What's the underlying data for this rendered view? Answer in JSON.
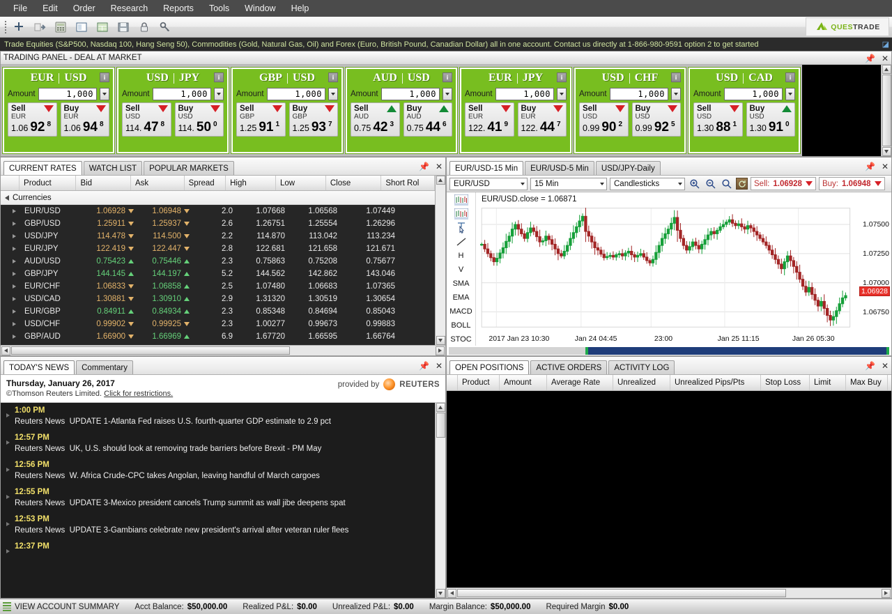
{
  "menu": {
    "items": [
      "File",
      "Edit",
      "Order",
      "Research",
      "Reports",
      "Tools",
      "Window",
      "Help"
    ]
  },
  "toolbar": {
    "icons": [
      "add-icon",
      "export-icon",
      "calculator-icon",
      "window-icon",
      "grid-icon",
      "save-icon",
      "lock-icon",
      "key-icon"
    ],
    "logo_ques": "QUES",
    "logo_trade": "TRADE"
  },
  "ticker": {
    "text": "Trade Equities (S&P500, Nasdaq 100, Hang Seng 50), Commodities (Gold, Natural Gas, Oil) and Forex (Euro, British Pound, Canadian Dollar) all in one account. Contact us directly at 1-866-980-9591 option 2 to get started"
  },
  "trading_panel": {
    "title": "TRADING PANEL - DEAL AT MARKET",
    "amount_label": "Amount",
    "info_label": "i",
    "sell_label": "Sell",
    "buy_label": "Buy",
    "tiles": [
      {
        "base": "EUR",
        "quote": "USD",
        "amount": "1,000",
        "sell_ccy": "EUR",
        "sell_pre": "1.06",
        "sell_big": "92",
        "sell_sup": "8",
        "sell_dir": "down",
        "buy_ccy": "EUR",
        "buy_pre": "1.06",
        "buy_big": "94",
        "buy_sup": "8",
        "buy_dir": "down"
      },
      {
        "base": "USD",
        "quote": "JPY",
        "amount": "1,000",
        "sell_ccy": "USD",
        "sell_pre": "114.",
        "sell_big": "47",
        "sell_sup": "8",
        "sell_dir": "down",
        "buy_ccy": "USD",
        "buy_pre": "114.",
        "buy_big": "50",
        "buy_sup": "0",
        "buy_dir": "down"
      },
      {
        "base": "GBP",
        "quote": "USD",
        "amount": "1,000",
        "sell_ccy": "GBP",
        "sell_pre": "1.25",
        "sell_big": "91",
        "sell_sup": "1",
        "sell_dir": "down",
        "buy_ccy": "GBP",
        "buy_pre": "1.25",
        "buy_big": "93",
        "buy_sup": "7",
        "buy_dir": "down"
      },
      {
        "base": "AUD",
        "quote": "USD",
        "amount": "1,000",
        "sell_ccy": "AUD",
        "sell_pre": "0.75",
        "sell_big": "42",
        "sell_sup": "3",
        "sell_dir": "up",
        "buy_ccy": "AUD",
        "buy_pre": "0.75",
        "buy_big": "44",
        "buy_sup": "6",
        "buy_dir": "up"
      },
      {
        "base": "EUR",
        "quote": "JPY",
        "amount": "1,000",
        "sell_ccy": "EUR",
        "sell_pre": "122.",
        "sell_big": "41",
        "sell_sup": "9",
        "sell_dir": "down",
        "buy_ccy": "EUR",
        "buy_pre": "122.",
        "buy_big": "44",
        "buy_sup": "7",
        "buy_dir": "down"
      },
      {
        "base": "USD",
        "quote": "CHF",
        "amount": "1,000",
        "sell_ccy": "USD",
        "sell_pre": "0.99",
        "sell_big": "90",
        "sell_sup": "2",
        "sell_dir": "down",
        "buy_ccy": "USD",
        "buy_pre": "0.99",
        "buy_big": "92",
        "buy_sup": "5",
        "buy_dir": "down"
      },
      {
        "base": "USD",
        "quote": "CAD",
        "amount": "1,000",
        "sell_ccy": "USD",
        "sell_pre": "1.30",
        "sell_big": "88",
        "sell_sup": "1",
        "sell_dir": "down",
        "buy_ccy": "USD",
        "buy_pre": "1.30",
        "buy_big": "91",
        "buy_sup": "0",
        "buy_dir": "up"
      }
    ]
  },
  "rates": {
    "tabs": [
      "CURRENT RATES",
      "WATCH LIST",
      "POPULAR MARKETS"
    ],
    "active_tab": "CURRENT RATES",
    "columns": [
      "Product",
      "Bid",
      "Ask",
      "Spread",
      "High",
      "Low",
      "Close",
      "Short Rol"
    ],
    "group_label": "Currencies",
    "rows": [
      {
        "product": "EUR/USD",
        "bid": "1.06928",
        "bid_dir": "down",
        "ask": "1.06948",
        "ask_dir": "down",
        "spread": "2.0",
        "high": "1.07668",
        "low": "1.06568",
        "close": "1.07449"
      },
      {
        "product": "GBP/USD",
        "bid": "1.25911",
        "bid_dir": "down",
        "ask": "1.25937",
        "ask_dir": "down",
        "spread": "2.6",
        "high": "1.26751",
        "low": "1.25554",
        "close": "1.26296"
      },
      {
        "product": "USD/JPY",
        "bid": "114.478",
        "bid_dir": "down",
        "ask": "114.500",
        "ask_dir": "down",
        "spread": "2.2",
        "high": "114.870",
        "low": "113.042",
        "close": "113.234"
      },
      {
        "product": "EUR/JPY",
        "bid": "122.419",
        "bid_dir": "down",
        "ask": "122.447",
        "ask_dir": "down",
        "spread": "2.8",
        "high": "122.681",
        "low": "121.658",
        "close": "121.671"
      },
      {
        "product": "AUD/USD",
        "bid": "0.75423",
        "bid_dir": "up",
        "ask": "0.75446",
        "ask_dir": "up",
        "spread": "2.3",
        "high": "0.75863",
        "low": "0.75208",
        "close": "0.75677"
      },
      {
        "product": "GBP/JPY",
        "bid": "144.145",
        "bid_dir": "up",
        "ask": "144.197",
        "ask_dir": "up",
        "spread": "5.2",
        "high": "144.562",
        "low": "142.862",
        "close": "143.046"
      },
      {
        "product": "EUR/CHF",
        "bid": "1.06833",
        "bid_dir": "down",
        "ask": "1.06858",
        "ask_dir": "up",
        "spread": "2.5",
        "high": "1.07480",
        "low": "1.06683",
        "close": "1.07365"
      },
      {
        "product": "USD/CAD",
        "bid": "1.30881",
        "bid_dir": "down",
        "ask": "1.30910",
        "ask_dir": "up",
        "spread": "2.9",
        "high": "1.31320",
        "low": "1.30519",
        "close": "1.30654"
      },
      {
        "product": "EUR/GBP",
        "bid": "0.84911",
        "bid_dir": "up",
        "ask": "0.84934",
        "ask_dir": "up",
        "spread": "2.3",
        "high": "0.85348",
        "low": "0.84694",
        "close": "0.85043"
      },
      {
        "product": "USD/CHF",
        "bid": "0.99902",
        "bid_dir": "down",
        "ask": "0.99925",
        "ask_dir": "down",
        "spread": "2.3",
        "high": "1.00277",
        "low": "0.99673",
        "close": "0.99883"
      },
      {
        "product": "GBP/AUD",
        "bid": "1.66900",
        "bid_dir": "down",
        "ask": "1.66969",
        "ask_dir": "up",
        "spread": "6.9",
        "high": "1.67720",
        "low": "1.66595",
        "close": "1.66764"
      }
    ]
  },
  "news": {
    "tabs": [
      "TODAY'S NEWS",
      "Commentary"
    ],
    "active_tab": "TODAY'S NEWS",
    "date": "Thursday, January 26, 2017",
    "copyright": "©Thomson Reuters Limited.",
    "restrictions_link": "Click for restrictions.",
    "provided_by": "provided by",
    "provider": "REUTERS",
    "items": [
      {
        "time": "1:00 PM",
        "source": "Reuters News",
        "headline": "UPDATE 1-Atlanta Fed raises U.S. fourth-quarter GDP estimate to 2.9 pct"
      },
      {
        "time": "12:57 PM",
        "source": "Reuters News",
        "headline": "UK, U.S. should look at removing trade barriers before Brexit - PM May"
      },
      {
        "time": "12:56 PM",
        "source": "Reuters News",
        "headline": "W. Africa Crude-CPC takes Angolan, leaving handful of March cargoes"
      },
      {
        "time": "12:55 PM",
        "source": "Reuters News",
        "headline": "UPDATE 3-Mexico president cancels Trump summit as wall jibe deepens spat"
      },
      {
        "time": "12:53 PM",
        "source": "Reuters News",
        "headline": "UPDATE 3-Gambians celebrate new president's arrival after veteran ruler flees"
      },
      {
        "time": "12:37 PM",
        "source": "",
        "headline": ""
      }
    ]
  },
  "chart": {
    "tabs": [
      "EUR/USD-15 Min",
      "EUR/USD-5 Min",
      "USD/JPY-Daily"
    ],
    "active_tab": "EUR/USD-15 Min",
    "symbol": "EUR/USD",
    "interval": "15 Min",
    "style": "Candlesticks",
    "sell_label": "Sell:",
    "sell_value": "1.06928",
    "buy_label": "Buy:",
    "buy_value": "1.06948",
    "tools": [
      "chart-bars-icon",
      "chart-candles-icon",
      "cursor-icon",
      "trendline-icon",
      "H",
      "V",
      "SMA",
      "EMA",
      "MACD",
      "BOLL",
      "STOC"
    ],
    "zoom_icons": [
      "zoom-in-icon",
      "zoom-out-icon",
      "zoom-reset-icon",
      "refresh-icon"
    ],
    "chart_data": {
      "type": "line",
      "title": "EUR/USD.close = 1.06871",
      "series_name": "EUR/USD close",
      "xlabel": "",
      "ylabel": "",
      "grid": true,
      "legend": "none",
      "ylim": [
        1.0662,
        1.0764
      ],
      "yticks": [
        1.075,
        1.0725,
        1.07,
        1.0675
      ],
      "ytick_labels": [
        "1.07500",
        "1.07250",
        "1.07000",
        "1.06750"
      ],
      "price_marker": "1.06928",
      "xticks": [
        "2017 Jan 23 10:30",
        "Jan 24 04:45",
        "23:00",
        "Jan 25 11:15",
        "Jan 26 05:30"
      ],
      "x": [
        0,
        1,
        2,
        3,
        4,
        5,
        6,
        7,
        8,
        9,
        10,
        11,
        12,
        13,
        14,
        15,
        16,
        17,
        18,
        19,
        20,
        21,
        22,
        23,
        24,
        25,
        26,
        27,
        28,
        29,
        30,
        31,
        32,
        33,
        34,
        35,
        36,
        37,
        38,
        39,
        40,
        41,
        42,
        43,
        44,
        45,
        46,
        47,
        48,
        49,
        50,
        51,
        52,
        53,
        54,
        55,
        56,
        57,
        58,
        59,
        60,
        61,
        62,
        63,
        64,
        65,
        66,
        67,
        68,
        69,
        70,
        71,
        72,
        73,
        74,
        75,
        76,
        77,
        78,
        79,
        80,
        81,
        82,
        83,
        84,
        85,
        86,
        87,
        88,
        89,
        90,
        91,
        92,
        93,
        94,
        95,
        96,
        97,
        98,
        99,
        100,
        101,
        102,
        103,
        104,
        105,
        106,
        107,
        108,
        109,
        110,
        111,
        112,
        113,
        114,
        115,
        116,
        117,
        118,
        119
      ],
      "values": [
        1.0733,
        1.0729,
        1.0725,
        1.07215,
        1.0718,
        1.0721,
        1.07255,
        1.073,
        1.07355,
        1.074,
        1.0746,
        1.075,
        1.0746,
        1.0742,
        1.0738,
        1.0743,
        1.0747,
        1.0744,
        1.07395,
        1.0735,
        1.0736,
        1.074,
        1.0737,
        1.0733,
        1.0729,
        1.0725,
        1.0723,
        1.0727,
        1.0732,
        1.0738,
        1.0743,
        1.0748,
        1.0753,
        1.0757,
        1.0744,
        1.074,
        1.0735,
        1.073,
        1.0728,
        1.07245,
        1.07215,
        1.07225,
        1.07235,
        1.0722,
        1.0724,
        1.0725,
        1.0723,
        1.07255,
        1.0727,
        1.0724,
        1.0722,
        1.07235,
        1.0725,
        1.0722,
        1.0719,
        1.0717,
        1.072,
        1.0726,
        1.0732,
        1.0738,
        1.0742,
        1.0746,
        1.0751,
        1.0756,
        1.0745,
        1.0738,
        1.0732,
        1.0728,
        1.0731,
        1.0735,
        1.0732,
        1.0729,
        1.0733,
        1.0737,
        1.0741,
        1.0744,
        1.0742,
        1.0745,
        1.0748,
        1.075,
        1.0752,
        1.0754,
        1.0751,
        1.0749,
        1.07505,
        1.0748,
        1.0746,
        1.0749,
        1.0747,
        1.0744,
        1.0741,
        1.0738,
        1.0735,
        1.0732,
        1.0728,
        1.0724,
        1.072,
        1.0716,
        1.0712,
        1.0718,
        1.0723,
        1.0719,
        1.0714,
        1.0709,
        1.0703,
        1.0697,
        1.0692,
        1.0696,
        1.069,
        1.0685,
        1.068,
        1.0684,
        1.0678,
        1.0672,
        1.0668,
        1.0671,
        1.0676,
        1.0682,
        1.0687,
        1.0689
      ]
    }
  },
  "positions": {
    "tabs": [
      "OPEN POSITIONS",
      "ACTIVE ORDERS",
      "ACTIVITY LOG"
    ],
    "active_tab": "OPEN POSITIONS",
    "columns": [
      "Product",
      "Amount",
      "Average Rate",
      "Unrealized",
      "Unrealized Pips/Pts",
      "Stop Loss",
      "Limit",
      "Max Buy"
    ],
    "rows": []
  },
  "status": {
    "summary_label": "VIEW ACCOUNT SUMMARY",
    "fields": [
      {
        "label": "Acct Balance:",
        "value": "$50,000.00"
      },
      {
        "label": "Realized P&L:",
        "value": "$0.00"
      },
      {
        "label": "Unrealized P&L:",
        "value": "$0.00"
      },
      {
        "label": "Margin Balance:",
        "value": "$50,000.00"
      },
      {
        "label": "Required Margin",
        "value": "$0.00"
      }
    ]
  }
}
